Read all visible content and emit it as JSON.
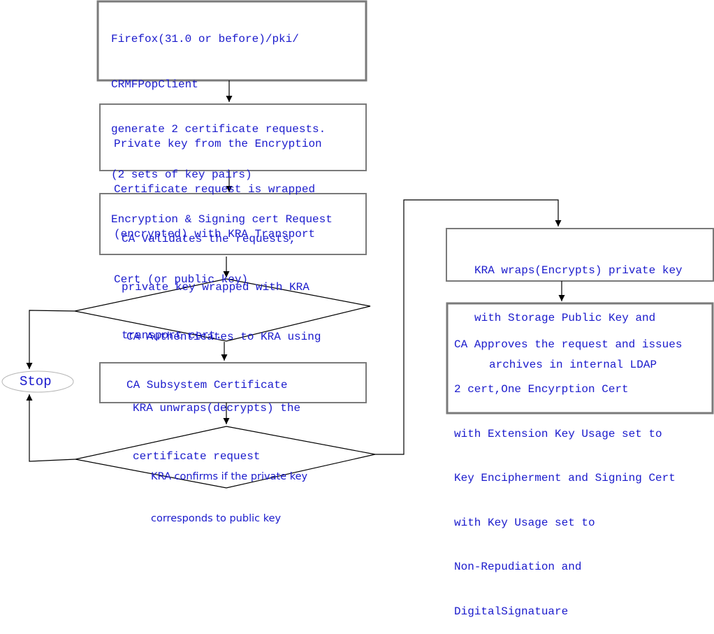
{
  "nodes": {
    "step1": {
      "lines": [
        "Firefox(31.0 or before)/pki/",
        "CRMFPopClient",
        "generate 2 certificate requests.",
        "(2 sets of key pairs)",
        "Encryption & Signing cert Request"
      ]
    },
    "step2": {
      "lines": [
        "Private key from the Encryption",
        "Certificate request is wrapped",
        "(encrypted) with KRA Transport",
        "Cert (or public key)"
      ]
    },
    "step3": {
      "lines": [
        "CA Validates the requests,",
        "private key wrapped with KRA",
        "transport cert."
      ]
    },
    "decision1": {
      "lines": [
        "CA Authenticates to KRA using",
        "CA Subsystem Certificate"
      ]
    },
    "step4": {
      "lines": [
        "KRA unwraps(decrypts) the",
        "certificate request"
      ]
    },
    "decision2": {
      "lines": [
        "KRA confirms if the private key",
        "corresponds to public key"
      ]
    },
    "step5": {
      "lines": [
        "KRA wraps(Encrypts) private key",
        "with Storage Public Key and",
        "archives in internal LDAP"
      ]
    },
    "step6": {
      "lines": [
        "CA Approves the request and issues",
        "2 cert,One Encyrption Cert",
        "with Extension Key Usage set to",
        "Key Encipherment and Signing Cert",
        "with Key Usage set to",
        "Non-Repudiation and",
        "DigitalSignatuare"
      ]
    },
    "stop": {
      "label": "Stop"
    }
  },
  "colors": {
    "box_border": "#7a7a7a",
    "connector": "#000000",
    "text": "#1a1acc",
    "stop_border": "#b5b5b5"
  }
}
